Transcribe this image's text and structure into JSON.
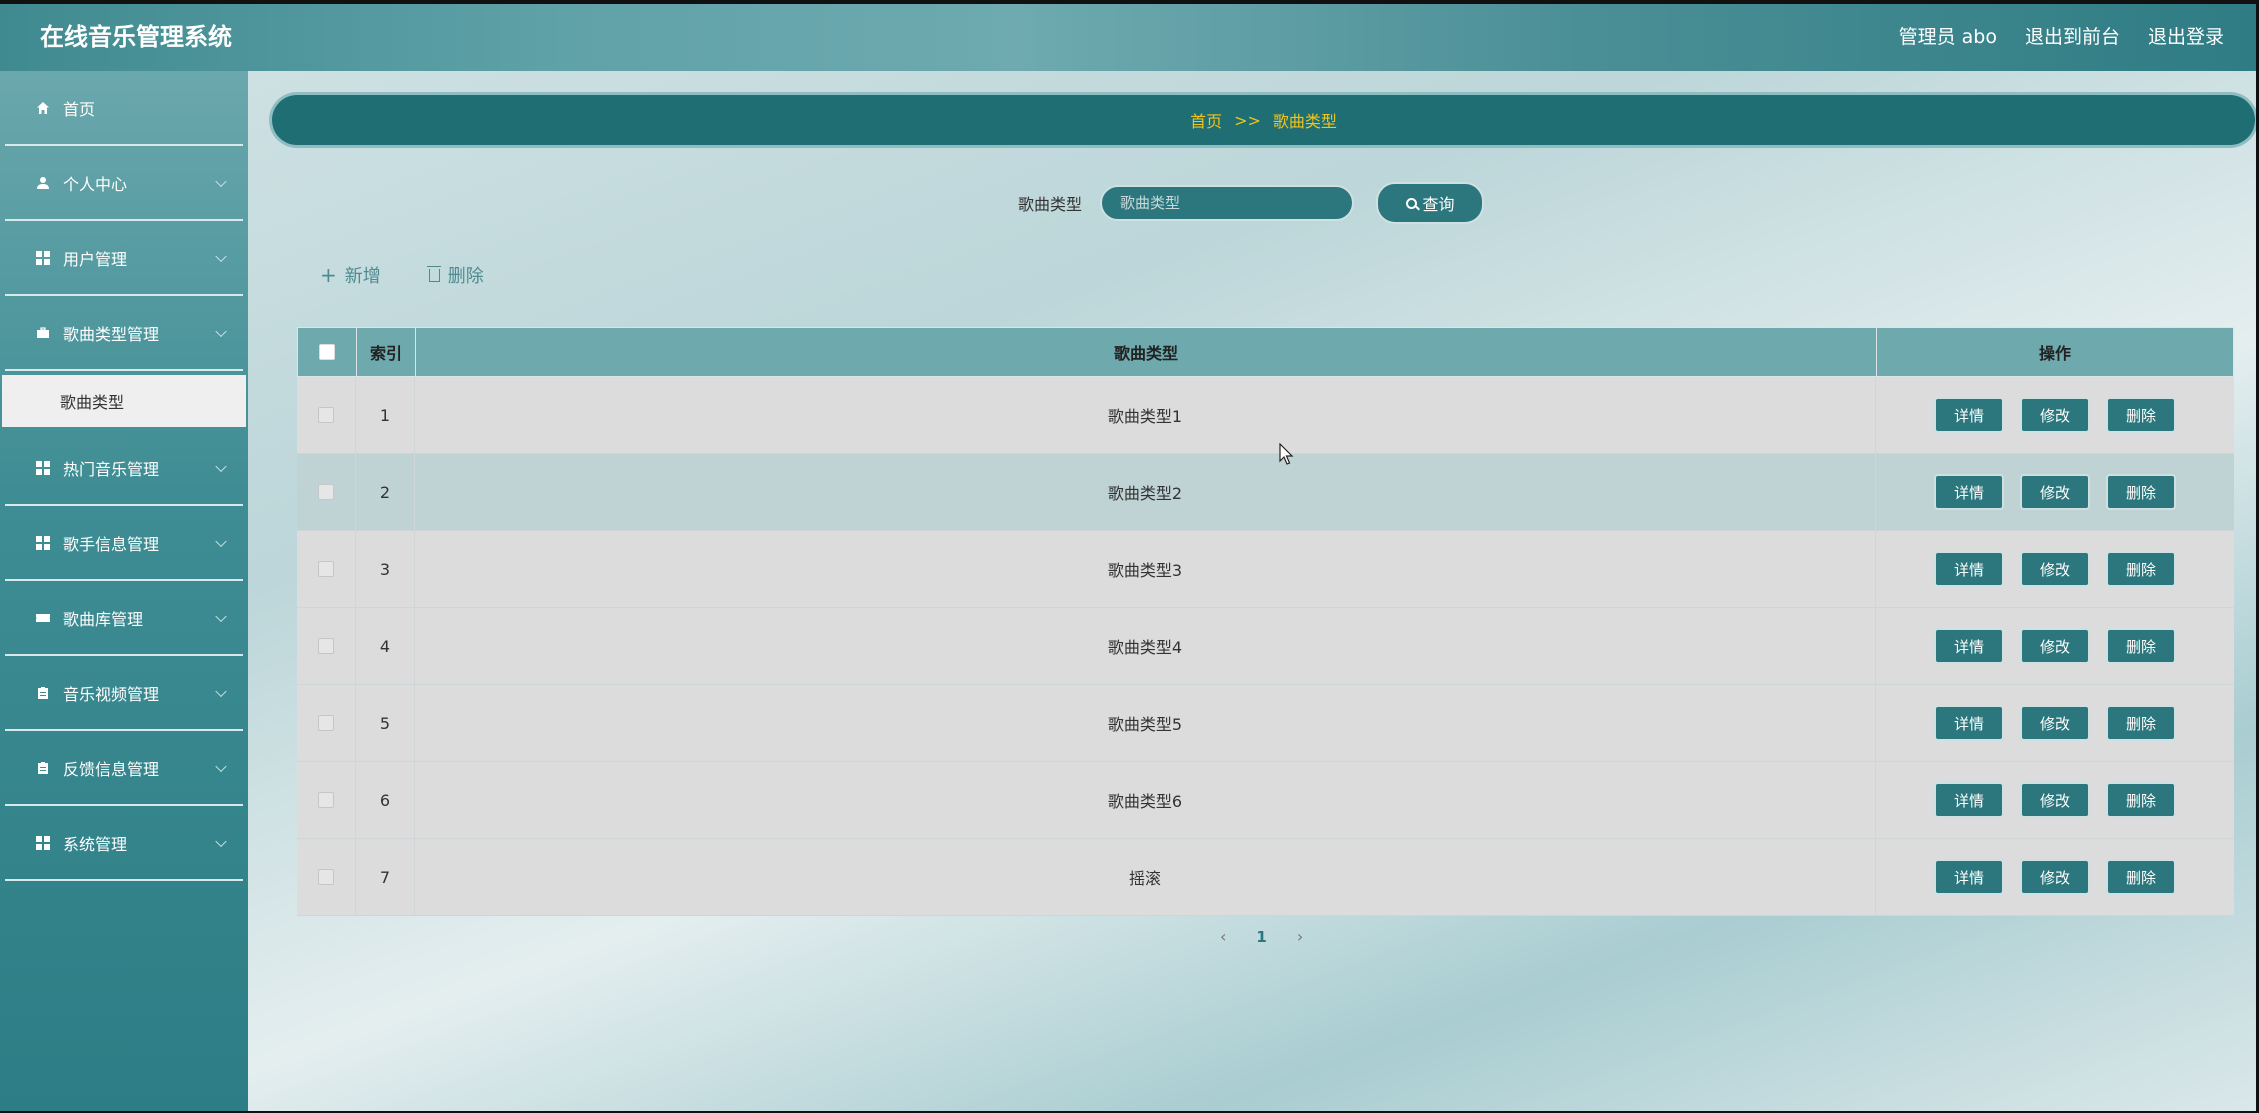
{
  "app": {
    "title": "在线音乐管理系统"
  },
  "header": {
    "user_label": "管理员 abo",
    "front_label": "退出到前台",
    "logout_label": "退出登录"
  },
  "sidebar": {
    "items": [
      {
        "label": "首页",
        "icon": "home-icon"
      },
      {
        "label": "个人中心",
        "icon": "user-icon"
      },
      {
        "label": "用户管理",
        "icon": "grid-icon"
      },
      {
        "label": "歌曲类型管理",
        "icon": "briefcase-icon"
      },
      {
        "label": "热门音乐管理",
        "icon": "grid-icon"
      },
      {
        "label": "歌手信息管理",
        "icon": "grid-icon"
      },
      {
        "label": "歌曲库管理",
        "icon": "ticket-icon"
      },
      {
        "label": "音乐视频管理",
        "icon": "clipboard-icon"
      },
      {
        "label": "反馈信息管理",
        "icon": "clipboard-icon"
      },
      {
        "label": "系统管理",
        "icon": "grid-icon"
      }
    ],
    "submenu": {
      "label": "歌曲类型"
    }
  },
  "breadcrumb": {
    "home": "首页",
    "sep": ">>",
    "current": "歌曲类型"
  },
  "search": {
    "label": "歌曲类型",
    "placeholder": "歌曲类型",
    "button": "查询"
  },
  "toolbar": {
    "add_label": "新增",
    "delete_label": "删除"
  },
  "table": {
    "headers": {
      "index": "索引",
      "type": "歌曲类型",
      "ops": "操作"
    },
    "rows": [
      {
        "index": "1",
        "type": "歌曲类型1"
      },
      {
        "index": "2",
        "type": "歌曲类型2"
      },
      {
        "index": "3",
        "type": "歌曲类型3"
      },
      {
        "index": "4",
        "type": "歌曲类型4"
      },
      {
        "index": "5",
        "type": "歌曲类型5"
      },
      {
        "index": "6",
        "type": "歌曲类型6"
      },
      {
        "index": "7",
        "type": "摇滚"
      }
    ],
    "row_actions": {
      "detail": "详情",
      "edit": "修改",
      "delete": "删除"
    }
  },
  "pagination": {
    "current": "1",
    "prev": "‹",
    "next": "›"
  },
  "colors": {
    "accent": "#2b777d",
    "breadcrumb_text": "#f0c419",
    "header_row": "#6ea9ae"
  }
}
